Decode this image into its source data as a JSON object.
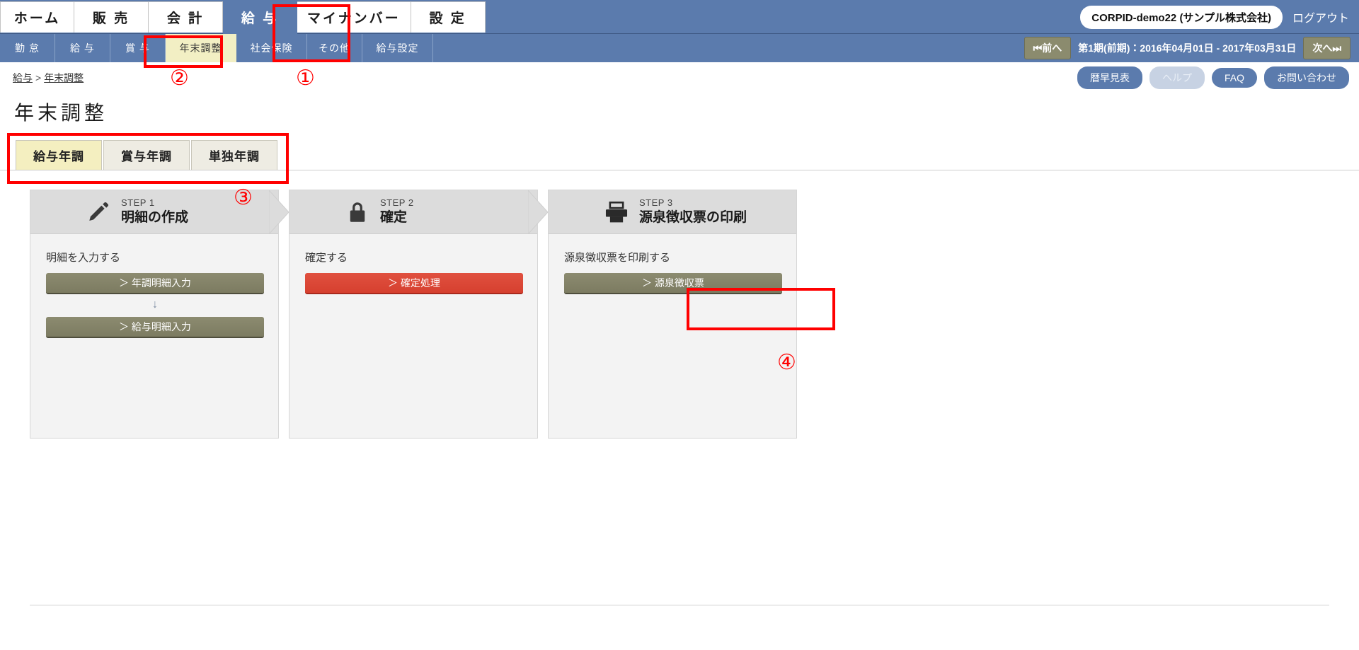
{
  "header": {
    "main_nav": [
      {
        "label": "ホーム",
        "active": false
      },
      {
        "label": "販 売",
        "active": false
      },
      {
        "label": "会 計",
        "active": false
      },
      {
        "label": "給 与",
        "active": true
      },
      {
        "label": "マイナンバー",
        "active": false
      },
      {
        "label": "設 定",
        "active": false
      }
    ],
    "company": "CORPID-demo22 (サンプル株式会社)",
    "logout_label": "ログアウト"
  },
  "subnav": {
    "items": [
      {
        "label": "勤 怠",
        "active": false
      },
      {
        "label": "給 与",
        "active": false
      },
      {
        "label": "賞 与",
        "active": false
      },
      {
        "label": "年末調整",
        "active": true
      },
      {
        "label": "社会保険",
        "active": false
      },
      {
        "label": "その他",
        "active": false
      },
      {
        "label": "給与設定",
        "active": false
      }
    ],
    "prev_label": "前へ",
    "next_label": "次へ",
    "period_text": "第1期(前期)：2016年04月01日 - 2017年03月31日"
  },
  "breadcrumb": {
    "parent": "給与",
    "separator": ">",
    "current": "年末調整"
  },
  "help_buttons": [
    {
      "label": "暦早見表",
      "dim": false
    },
    {
      "label": "ヘルプ",
      "dim": true
    },
    {
      "label": "FAQ",
      "dim": false
    },
    {
      "label": "お問い合わせ",
      "dim": false
    }
  ],
  "page": {
    "title": "年末調整"
  },
  "year_tabs": [
    {
      "label": "給与年調",
      "active": true
    },
    {
      "label": "賞与年調",
      "active": false
    },
    {
      "label": "単独年調",
      "active": false
    }
  ],
  "steps": [
    {
      "step_num": "STEP 1",
      "name": "明細の作成",
      "icon": "pencil-icon",
      "lead": "明細を入力する",
      "buttons": [
        {
          "label": "＞ 年調明細入力",
          "style": "olive"
        },
        {
          "label": "＞ 給与明細入力",
          "style": "olive"
        }
      ],
      "arrow": "↓",
      "has_arrow": true
    },
    {
      "step_num": "STEP 2",
      "name": "確定",
      "icon": "lock-icon",
      "lead": "確定する",
      "buttons": [
        {
          "label": "＞ 確定処理",
          "style": "red"
        }
      ],
      "has_arrow": false
    },
    {
      "step_num": "STEP 3",
      "name": "源泉徴収票の印刷",
      "icon": "printer-icon",
      "lead": "源泉徴収票を印刷する",
      "buttons": [
        {
          "label": "＞ 源泉徴収票",
          "style": "olive"
        }
      ],
      "has_arrow": false
    }
  ],
  "annotations": [
    {
      "marker": "①",
      "target": "main-nav-payroll"
    },
    {
      "marker": "②",
      "target": "subnav-year-end-adjustment"
    },
    {
      "marker": "③",
      "target": "year-tabs-group"
    },
    {
      "marker": "④",
      "target": "withholding-slip-button"
    }
  ],
  "colors": {
    "nav_blue": "#5b7bad",
    "active_tab_cream": "#f4efc0",
    "olive_button": "#8c8b70",
    "red_button": "#d6402f",
    "annotation_red": "#ff0000"
  }
}
